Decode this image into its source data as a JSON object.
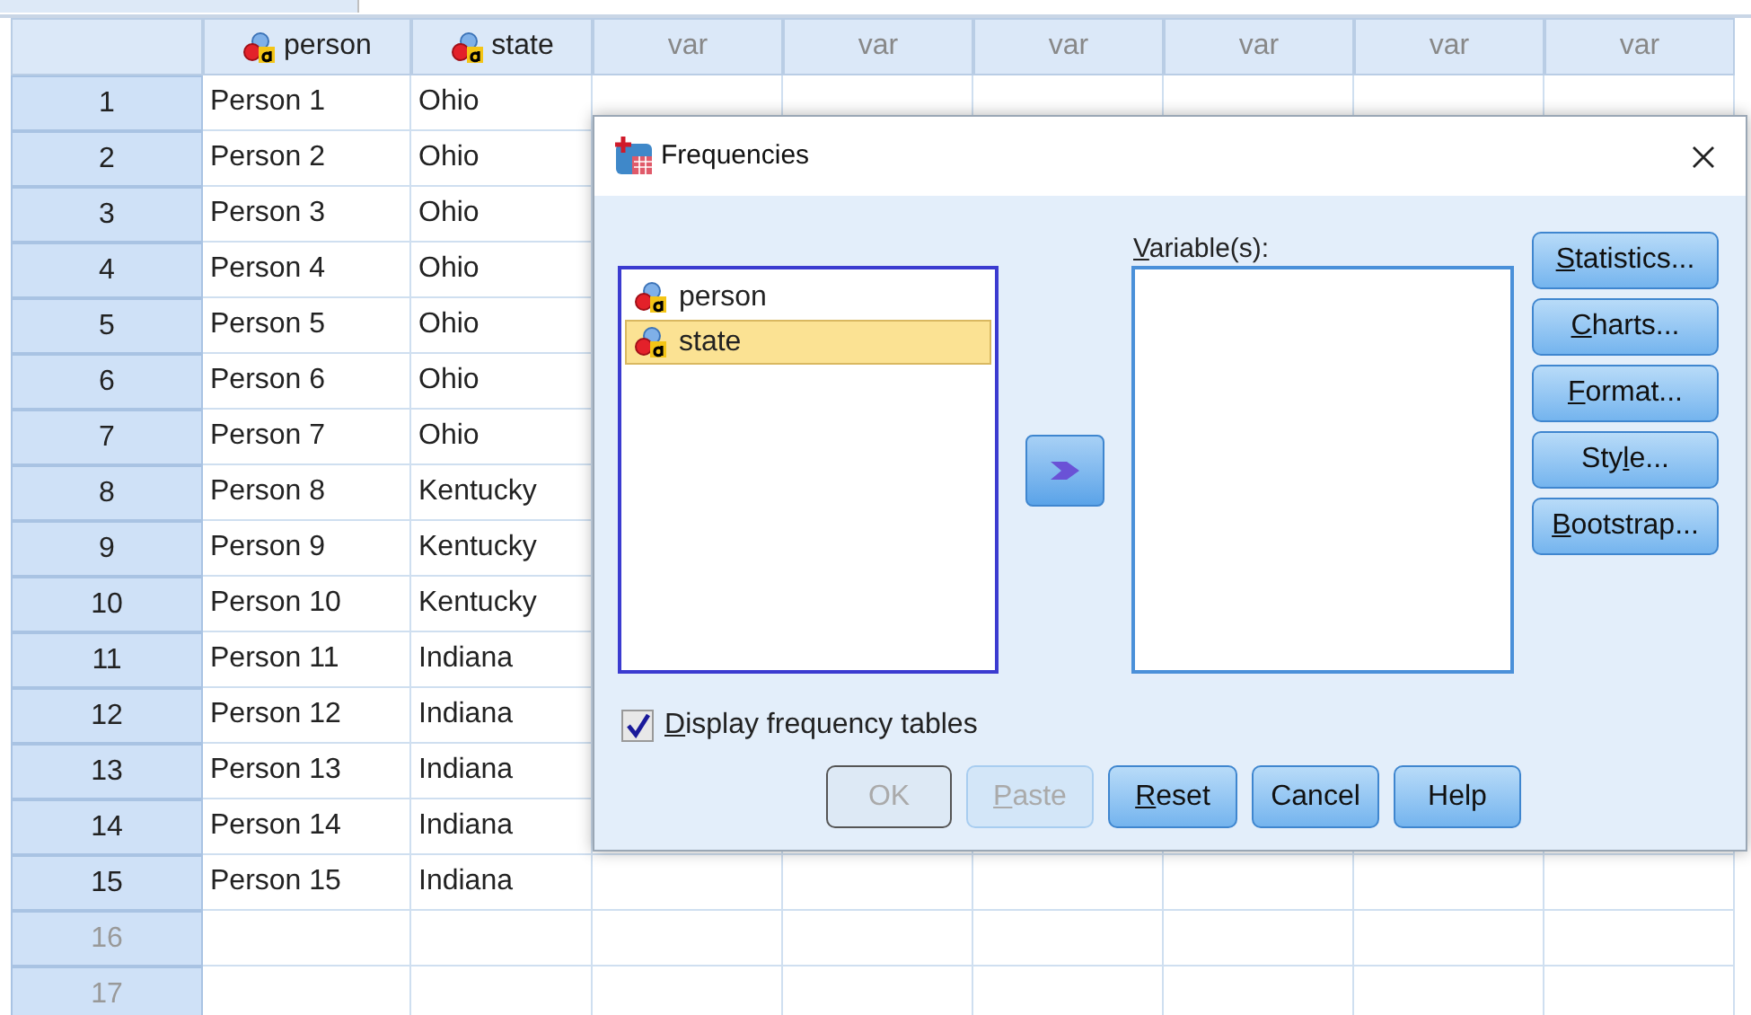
{
  "data_view": {
    "columns": [
      {
        "kind": "variable",
        "label": "person"
      },
      {
        "kind": "variable",
        "label": "state"
      },
      {
        "kind": "empty",
        "label": "var"
      },
      {
        "kind": "empty",
        "label": "var"
      },
      {
        "kind": "empty",
        "label": "var"
      },
      {
        "kind": "empty",
        "label": "var"
      },
      {
        "kind": "empty",
        "label": "var"
      },
      {
        "kind": "empty",
        "label": "var"
      }
    ],
    "rows": [
      {
        "number": "1",
        "has_data": true,
        "cells": [
          "Person 1",
          "Ohio"
        ]
      },
      {
        "number": "2",
        "has_data": true,
        "cells": [
          "Person 2",
          "Ohio"
        ]
      },
      {
        "number": "3",
        "has_data": true,
        "cells": [
          "Person 3",
          "Ohio"
        ]
      },
      {
        "number": "4",
        "has_data": true,
        "cells": [
          "Person 4",
          "Ohio"
        ]
      },
      {
        "number": "5",
        "has_data": true,
        "cells": [
          "Person 5",
          "Ohio"
        ]
      },
      {
        "number": "6",
        "has_data": true,
        "cells": [
          "Person 6",
          "Ohio"
        ]
      },
      {
        "number": "7",
        "has_data": true,
        "cells": [
          "Person 7",
          "Ohio"
        ]
      },
      {
        "number": "8",
        "has_data": true,
        "cells": [
          "Person 8",
          "Kentucky"
        ]
      },
      {
        "number": "9",
        "has_data": true,
        "cells": [
          "Person 9",
          "Kentucky"
        ]
      },
      {
        "number": "10",
        "has_data": true,
        "cells": [
          "Person 10",
          "Kentucky"
        ]
      },
      {
        "number": "11",
        "has_data": true,
        "cells": [
          "Person 11",
          "Indiana"
        ]
      },
      {
        "number": "12",
        "has_data": true,
        "cells": [
          "Person 12",
          "Indiana"
        ]
      },
      {
        "number": "13",
        "has_data": true,
        "cells": [
          "Person 13",
          "Indiana"
        ]
      },
      {
        "number": "14",
        "has_data": true,
        "cells": [
          "Person 14",
          "Indiana"
        ]
      },
      {
        "number": "15",
        "has_data": true,
        "cells": [
          "Person 15",
          "Indiana"
        ]
      },
      {
        "number": "16",
        "has_data": false,
        "cells": []
      },
      {
        "number": "17",
        "has_data": false,
        "cells": []
      }
    ]
  },
  "dialog": {
    "title": "Frequencies",
    "source_variables": [
      {
        "name": "person",
        "selected": false
      },
      {
        "name": "state",
        "selected": true
      }
    ],
    "target_label": {
      "key": "V",
      "after": "ariable(s):"
    },
    "side_buttons": [
      {
        "label": {
          "key": "S",
          "after": "tatistics..."
        }
      },
      {
        "label": {
          "key": "C",
          "after": "harts..."
        }
      },
      {
        "label": {
          "key": "F",
          "after": "ormat..."
        }
      },
      {
        "label": {
          "before": "Sty",
          "key": "l",
          "after": "e..."
        }
      },
      {
        "label": {
          "key": "B",
          "after": "ootstrap..."
        }
      }
    ],
    "display_tables": {
      "label": {
        "key": "D",
        "after": "isplay frequency tables"
      },
      "checked": true
    },
    "buttons": [
      {
        "label": {
          "before": "OK"
        },
        "disabled": true,
        "default": true
      },
      {
        "label": {
          "key": "P",
          "after": "aste"
        },
        "disabled": true,
        "default": false
      },
      {
        "label": {
          "key": "R",
          "after": "eset"
        },
        "disabled": false,
        "default": false
      },
      {
        "label": {
          "before": "Cancel"
        },
        "disabled": false,
        "default": false
      },
      {
        "label": {
          "before": "Help"
        },
        "disabled": false,
        "default": false
      }
    ]
  }
}
